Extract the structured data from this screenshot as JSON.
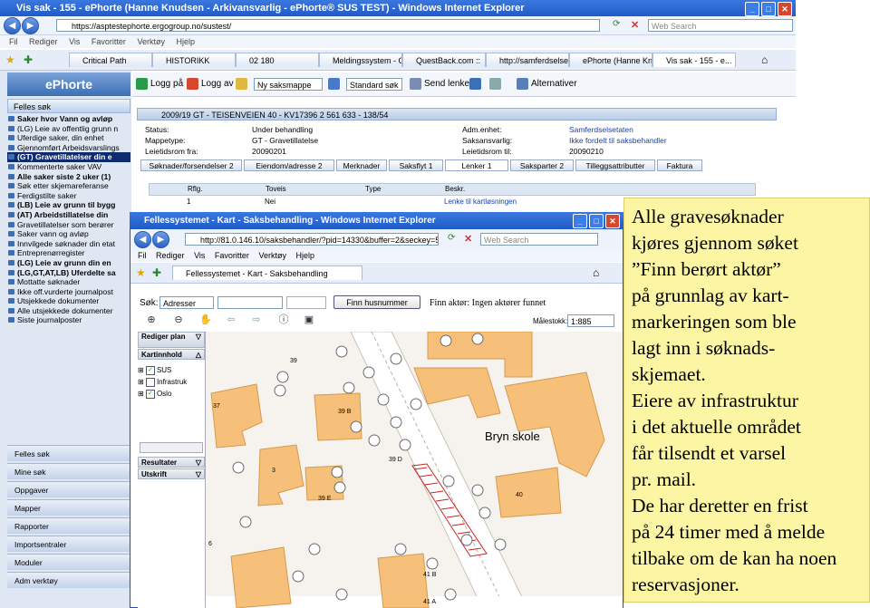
{
  "back_window": {
    "title": "Vis sak - 155 - ePhorte (Hanne Knudsen - Arkivansvarlig - ePhorte® SUS TEST) - Windows Internet Explorer",
    "address": "https://asptestephorte.ergogroup.no/sustest/",
    "search_placeholder": "Web Search",
    "menu": [
      "Fil",
      "Rediger",
      "Vis",
      "Favoritter",
      "Verktøy",
      "Hjelp"
    ],
    "tabs": [
      "Critical Path",
      "HISTORIKK",
      "02 180",
      "Meldingssystem - O...",
      "QuestBack.com ::",
      "http://samferdselse...",
      "ePhorte (Hanne Kn...",
      "Vis sak - 155 - e..."
    ],
    "brand": "ePhorte",
    "left_top_section": "Felles søk",
    "left_items": [
      "Saker hvor Vann og avløp",
      "(LG) Leie av offentlig grunn n",
      "Uferdige saker, din enhet",
      "Gjennomført Arbeidsvarslings",
      "(GT) Gravetillatelser din e",
      "Kommenterte saker VAV",
      "Alle saker siste 2 uker (1)",
      "Søk etter skjemareferanse",
      "Ferdigstilte saker",
      "(LB) Leie av grunn til bygg",
      "(AT) Arbeidstillatelse din",
      "Gravetillatelser som berører",
      "Saker vann og avløp",
      "Innvilgede søknader din etat",
      "Entreprenørregister",
      "(LG) Leie av grunn din en",
      "(LG,GT,AT,LB) Uferdelte sa",
      "Mottatte søknader",
      "Ikke off.vurderte journalpost",
      "Utsjekkede dokumenter",
      "Alle utsjekkede dokumenter",
      "Siste journalposter"
    ],
    "left_nav": [
      "Felles søk",
      "Mine søk",
      "Oppgaver",
      "Mapper",
      "Rapporter",
      "Importsentraler",
      "Moduler",
      "Adm verktøy"
    ],
    "toolbar": {
      "logg_pa": "Logg på",
      "logg_av": "Logg av",
      "saksmappe": "Ny saksmappe",
      "standard_sok": "Standard søk",
      "send_lenke": "Send lenke",
      "alternativer": "Alternativer"
    },
    "case_header": "2009/19  GT - TEISENVEIEN 40 - KV17396 2 561 633 - 138/54",
    "info": {
      "status_label": "Status:",
      "status": "Under behandling",
      "mappetype_label": "Mappetype:",
      "mappetype": "GT - Gravetillatelse",
      "leietid_fra_label": "Leietidsrom fra:",
      "leietid_fra": "20090201",
      "adm_label": "Adm.enhet:",
      "adm": "Samferdselsetaten",
      "saksansvarlig_label": "Saksansvarlig:",
      "saksansvarlig": "Ikke fordelt til saksbehandler",
      "leietid_til_label": "Leietidsrom til:",
      "leietid_til": "20090210"
    },
    "case_tabs": [
      "Søknader/forsendelser",
      "Eiendom/adresse",
      "Merknader",
      "Saksflyt",
      "Lenker",
      "Saksparter",
      "Tilleggsattributter",
      "Faktura"
    ],
    "case_tab_counts": [
      "2",
      "2",
      "",
      "1",
      "1",
      "2",
      "",
      ""
    ],
    "grid_headers": [
      "Rflg.",
      "Toveis",
      "Type",
      "Beskr."
    ],
    "grid_row": [
      "1",
      "Nei",
      "",
      "Lenke til kartløsningen"
    ]
  },
  "front_window": {
    "title": "Fellessystemet - Kart - Saksbehandling - Windows Internet Explorer",
    "address": "http://81.0.146.10/saksbehandler/?pid=14330&buffer=2&seckey=5eda69c0-5",
    "search_placeholder": "Web Search",
    "menu": [
      "Fil",
      "Rediger",
      "Vis",
      "Favoritter",
      "Verktøy",
      "Hjelp"
    ],
    "fav_tab": "Fellessystemet - Kart - Saksbehandling",
    "sok_label": "Søk:",
    "sok_type": "Adresser",
    "finn_button": "Finn husnummer",
    "finn_aktor": "Finn aktør: Ingen aktører funnet",
    "malestokk_label": "Målestokk:",
    "malestokk": "1:885",
    "pane_rediger": "Rediger plan",
    "pane_kartinnhold": "Kartinnhold",
    "layers": [
      "SUS",
      "Infrastruk",
      "Oslo"
    ],
    "pane_resultater": "Resultater",
    "pane_utskrift": "Utskrift",
    "map_labels": {
      "school": "Bryn skole",
      "n39": "39",
      "n39b": "39 B",
      "n37": "37",
      "n39d": "39 D",
      "n3": "3",
      "n39e": "39 E",
      "n40": "40",
      "n6": "6",
      "n41b": "41 B",
      "n41a": "41 A"
    }
  },
  "note_lines": [
    "Alle gravesøknader",
    "kjøres gjennom søket",
    "”Finn berørt aktør”",
    "på grunnlag av kart-",
    "markeringen som ble",
    "lagt inn i søknads-",
    "skjemaet.",
    "Eiere av infrastruktur",
    "i det aktuelle området",
    "får tilsendt et varsel",
    "pr. mail.",
    "De har deretter en frist",
    "på 24 timer med å melde",
    "tilbake om de kan ha noen",
    "reservasjoner."
  ]
}
